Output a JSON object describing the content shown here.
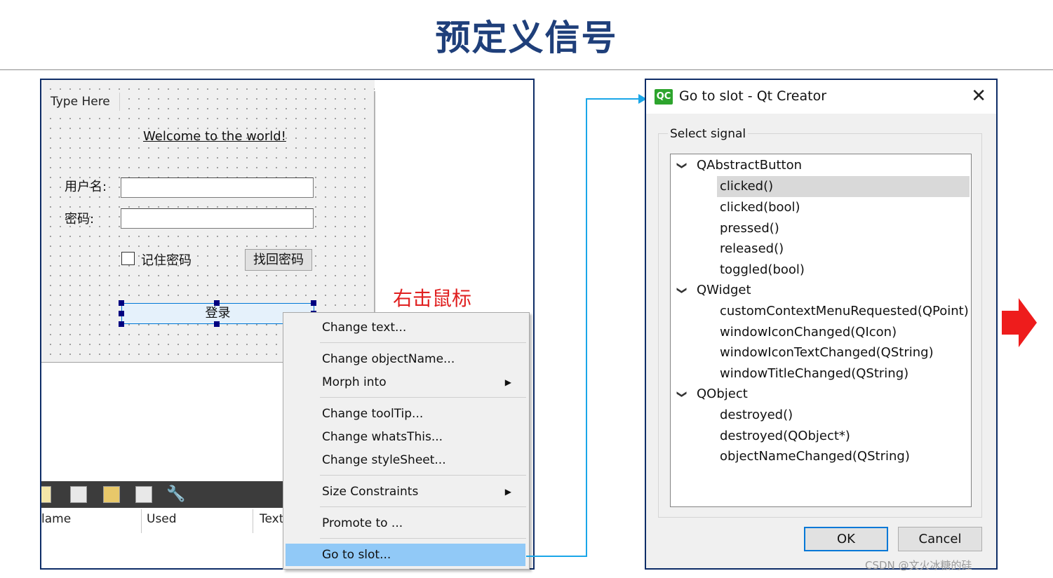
{
  "slide": {
    "title": "预定义信号"
  },
  "designer": {
    "menu_placeholder": "Type Here",
    "welcome": "Welcome to the world!",
    "username_label": "用户名:",
    "password_label": "密码:",
    "remember_label": "记住密码",
    "find_password": "找回密码",
    "login": "登录",
    "columns": {
      "name": "lame",
      "used": "Used",
      "text": "Text"
    }
  },
  "hint": "右击鼠标",
  "context_menu": {
    "items": [
      "Change text...",
      "Change objectName...",
      "Morph into",
      "Change toolTip...",
      "Change whatsThis...",
      "Change styleSheet...",
      "Size Constraints",
      "Promote to ...",
      "Go to slot..."
    ],
    "submenu_arrow": "▶"
  },
  "dialog": {
    "icon": "QC",
    "title": "Go to slot - Qt Creator",
    "close": "✕",
    "group_title": "Select signal",
    "groups": [
      {
        "name": "QAbstractButton",
        "signals": [
          "clicked()",
          "clicked(bool)",
          "pressed()",
          "released()",
          "toggled(bool)"
        ]
      },
      {
        "name": "QWidget",
        "signals": [
          "customContextMenuRequested(QPoint)",
          "windowIconChanged(QIcon)",
          "windowIconTextChanged(QString)",
          "windowTitleChanged(QString)"
        ]
      },
      {
        "name": "QObject",
        "signals": [
          "destroyed()",
          "destroyed(QObject*)",
          "objectNameChanged(QString)"
        ]
      }
    ],
    "chevron": "❯",
    "ok": "OK",
    "cancel": "Cancel"
  },
  "watermark": "CSDN @文火冰糖的硅",
  "colors": {
    "highlight": "#91c9f7",
    "connector": "#1aa6e8",
    "accent_red": "#ee1c1c",
    "title_blue": "#1f3f7a"
  }
}
